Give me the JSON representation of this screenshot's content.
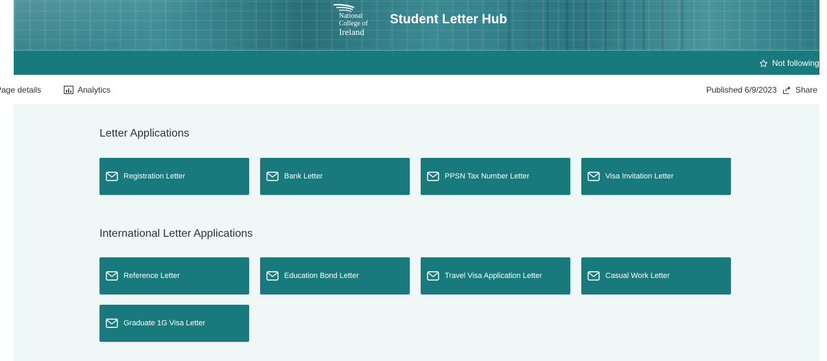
{
  "header": {
    "logo_lines": [
      "National",
      "College of",
      "Ireland"
    ],
    "title": "Student Letter Hub"
  },
  "navbar": {
    "follow_label": "Not following"
  },
  "commandbar": {
    "page_details": "Page details",
    "analytics": "Analytics",
    "published": "Published 6/9/2023",
    "share": "Share"
  },
  "sections": [
    {
      "title": "Letter Applications",
      "tiles": [
        "Registration Letter",
        "Bank Letter",
        "PPSN Tax Number Letter",
        "Visa Invitation Letter"
      ]
    },
    {
      "title": "International Letter Applications",
      "tiles": [
        "Reference Letter",
        "Education Bond Letter",
        "Travel Visa Application Letter",
        "Casual Work Letter",
        "Graduate 1G Visa Letter"
      ]
    }
  ],
  "colors": {
    "accent": "#197a7d",
    "content_background": "#f0f7f7"
  }
}
